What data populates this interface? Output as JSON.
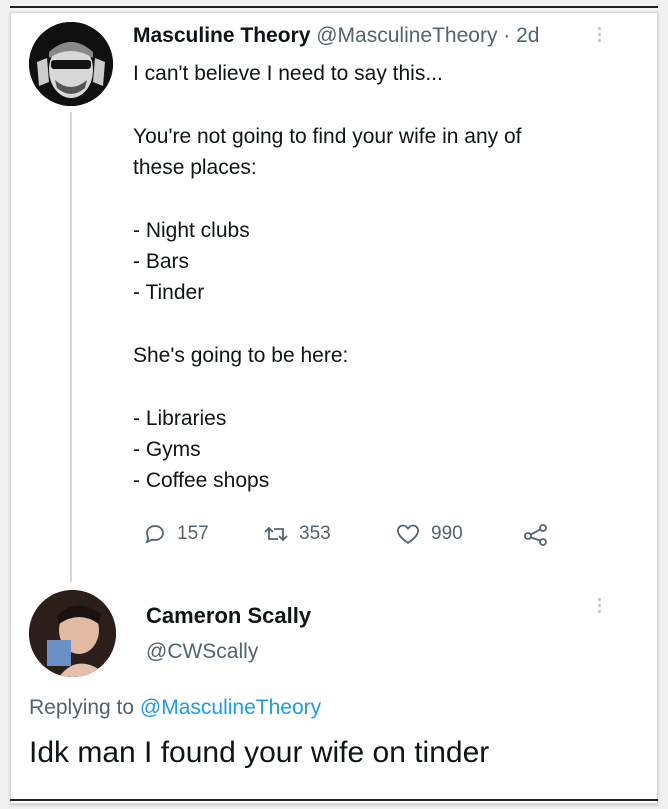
{
  "tweet": {
    "author_name": "Masculine Theory",
    "author_handle": "@MasculineTheory",
    "separator": " · ",
    "time": "2d",
    "lines": {
      "l1": "I can't believe I need to say this...",
      "l2": "You're not going to find your wife in any of",
      "l3": "these places:",
      "l4": "- Night clubs",
      "l5": "- Bars",
      "l6": "- Tinder",
      "l7": "She's going to be here:",
      "l8": "- Libraries",
      "l9": "- Gyms",
      "l10": "- Coffee shops"
    },
    "stats": {
      "replies": "157",
      "retweets": "353",
      "likes": "990"
    }
  },
  "reply": {
    "author_name": "Cameron Scally",
    "author_handle": "@CWScally",
    "replying_prefix": "Replying to ",
    "replying_handle": "@MasculineTheory",
    "text": "Idk man I found your wife on tinder"
  },
  "colors": {
    "text": "#0f1419",
    "muted": "#536471",
    "link": "#1d9bf0"
  }
}
